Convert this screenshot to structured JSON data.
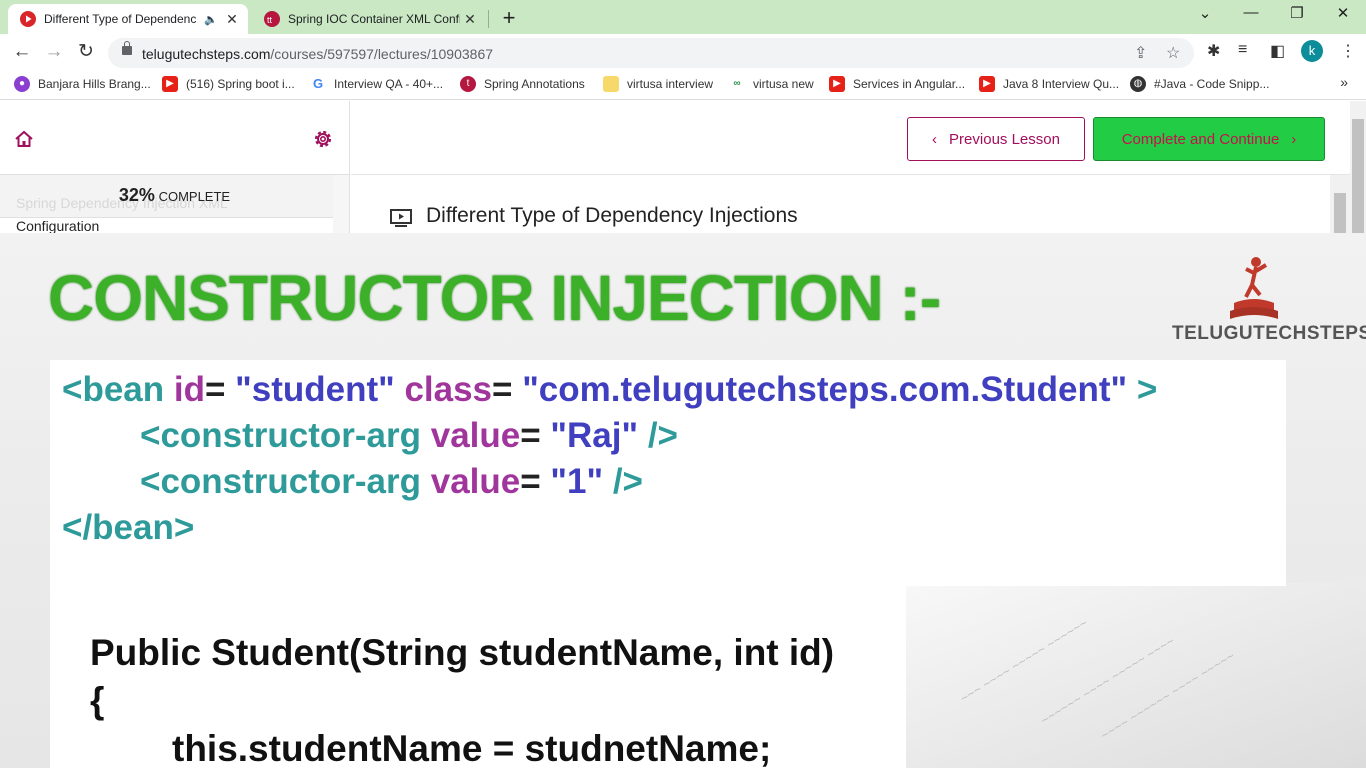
{
  "tabs": [
    {
      "title": "Different Type of Dependenc",
      "active": true
    },
    {
      "title": "Spring IOC Container XML Config",
      "active": false
    }
  ],
  "omnibox": {
    "url_host": "telugutechsteps.com",
    "url_path": "/courses/597597/lectures/10903867"
  },
  "profile": {
    "initial": "k"
  },
  "bookmarks": [
    "Banjara Hills Brang...",
    "(516) Spring boot i...",
    "Interview QA - 40+...",
    "Spring Annotations",
    "virtusa interview",
    "virtusa new",
    "Services in Angular...",
    "Java 8 Interview Qu...",
    "#Java - Code Snipp..."
  ],
  "sidebar": {
    "progress_value": "32%",
    "progress_label": "COMPLETE",
    "progress_fraction": 0.32,
    "faded_section": "Spring Dependency Injection XML",
    "section_title": "Configuration"
  },
  "lesson": {
    "prev_label": "Previous Lesson",
    "next_label": "Complete and Continue",
    "title": "Different Type of Dependency Injections"
  },
  "slide": {
    "heading": "CONSTRUCTOR INJECTION :-",
    "brand": "TELUGUTECHSTEPS",
    "xml": {
      "l1_open": "<bean ",
      "l1_id": "id",
      "l1_eq1": "= ",
      "l1_idval": "\"student\" ",
      "l1_class": "class",
      "l1_eq2": "= ",
      "l1_classval": "\"com.telugutechsteps.com.Student\" ",
      "l1_close": ">",
      "l2_tag": "<constructor-arg ",
      "l2_attr": "value",
      "l2_eq": "= ",
      "l2_val": "\"Raj\" ",
      "l2_close": "/>",
      "l3_tag": "<constructor-arg ",
      "l3_attr": "value",
      "l3_eq": "= ",
      "l3_val": "\"1\" ",
      "l3_close": "/>",
      "l4": "</bean>"
    },
    "java": {
      "line1": "Public Student(String studentName, int id)",
      "line2": "{",
      "line3": "this.studentName = studnetName;"
    }
  },
  "colors": {
    "tabstrip": "#c9e8c3",
    "accent": "#a1105c",
    "complete_button": "#22cc44",
    "slide_green": "#3cb029"
  }
}
